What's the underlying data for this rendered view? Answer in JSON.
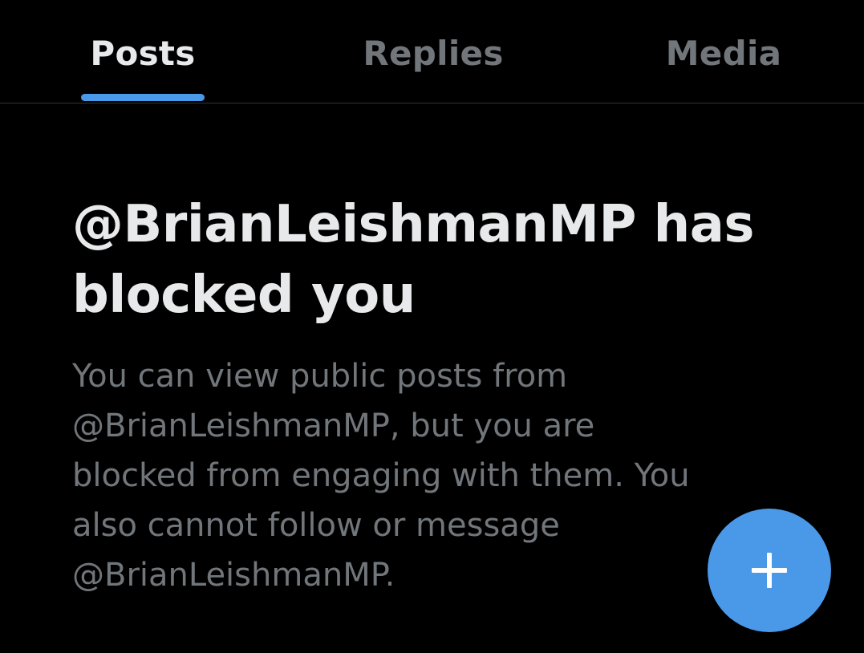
{
  "tabs": [
    {
      "label": "Posts",
      "active": true
    },
    {
      "label": "Replies",
      "active": false
    },
    {
      "label": "Media",
      "active": false
    }
  ],
  "blocked": {
    "title": "@BrianLeishmanMP has blocked you",
    "body": "You can view public posts from @BrianLeishmanMP, but you are blocked from engaging with them. You also cannot follow or message @BrianLeishmanMP."
  },
  "fab": {
    "icon": "plus-icon"
  },
  "colors": {
    "background": "#000000",
    "primary_text": "#e7e9ea",
    "secondary_text": "#71767b",
    "accent": "#4a99e9",
    "divider": "#2f3336"
  }
}
